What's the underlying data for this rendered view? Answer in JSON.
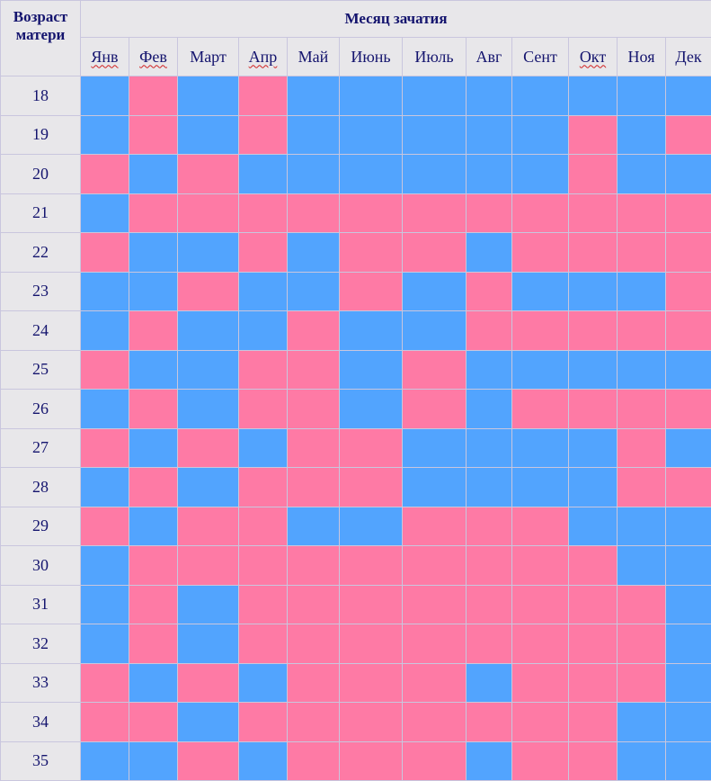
{
  "header": {
    "age_label": "Возраст матери",
    "month_label": "Месяц зачатия"
  },
  "months": [
    {
      "label": "Янв",
      "spell": true
    },
    {
      "label": "Фев",
      "spell": true
    },
    {
      "label": "Март",
      "spell": false
    },
    {
      "label": "Апр",
      "spell": true
    },
    {
      "label": "Май",
      "spell": false
    },
    {
      "label": "Июнь",
      "spell": false
    },
    {
      "label": "Июль",
      "spell": false
    },
    {
      "label": "Авг",
      "spell": false
    },
    {
      "label": "Сент",
      "spell": false
    },
    {
      "label": "Окт",
      "spell": true
    },
    {
      "label": "Ноя",
      "spell": false
    },
    {
      "label": "Дек",
      "spell": false
    }
  ],
  "colors": {
    "B": "#52a4fe",
    "P": "#fe7aa5"
  },
  "rows": [
    {
      "age": "18",
      "cells": "BPBPBBBBBBBB"
    },
    {
      "age": "19",
      "cells": "BPBPBBBBBPBP"
    },
    {
      "age": "20",
      "cells": "PBPBBBBBBPBB"
    },
    {
      "age": "21",
      "cells": "BPPPPPPPPPPP"
    },
    {
      "age": "22",
      "cells": "PBBPBPPBPPPP"
    },
    {
      "age": "23",
      "cells": "BBPBBPBPBBBP"
    },
    {
      "age": "24",
      "cells": "BPBBPBBPPPPP"
    },
    {
      "age": "25",
      "cells": "PBBPPBPBBBBB"
    },
    {
      "age": "26",
      "cells": "BPBPPBPBPPPP"
    },
    {
      "age": "27",
      "cells": "PBPBPPBBBBPB"
    },
    {
      "age": "28",
      "cells": "BPBPPPBBBBPP"
    },
    {
      "age": "29",
      "cells": "PBPPBBPPPBBB"
    },
    {
      "age": "30",
      "cells": "BPPPPPPPPPBB"
    },
    {
      "age": "31",
      "cells": "BPBPPPPPPPPB"
    },
    {
      "age": "32",
      "cells": "BPBPPPPPPPPB"
    },
    {
      "age": "33",
      "cells": "PBPBPPPBPPPB"
    },
    {
      "age": "34",
      "cells": "PPBPPPPPPPBB"
    },
    {
      "age": "35",
      "cells": "BBPBPPPBPPBB"
    }
  ]
}
